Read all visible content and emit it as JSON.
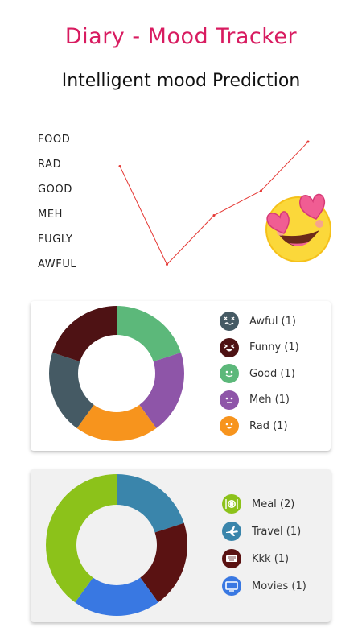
{
  "header": {
    "title": "Diary - Mood Tracker",
    "subtitle": "Intelligent mood Prediction"
  },
  "chart_data": [
    {
      "type": "line",
      "title": "",
      "y_categories": [
        "FOOD",
        "RAD",
        "GOOD",
        "MEH",
        "FUGLY",
        "AWFUL"
      ],
      "series": [
        {
          "values": [
            "RAD",
            "AWFUL",
            "MEH",
            "GOOD",
            "FOOD"
          ],
          "color": "#e53935"
        }
      ]
    },
    {
      "type": "pie",
      "donut": true,
      "slices": [
        {
          "label": "Awful (1)",
          "value": 1,
          "color": "#455a64",
          "icon": "dizzy-face-icon"
        },
        {
          "label": "Funny (1)",
          "value": 1,
          "color": "#4e1214",
          "icon": "laughing-face-icon"
        },
        {
          "label": "Good (1)",
          "value": 1,
          "color": "#5cb87a",
          "icon": "smiling-face-icon"
        },
        {
          "label": "Meh (1)",
          "value": 1,
          "color": "#8e55a8",
          "icon": "neutral-face-icon"
        },
        {
          "label": "Rad (1)",
          "value": 1,
          "color": "#f7941d",
          "icon": "happy-face-icon"
        }
      ],
      "chart_order": [
        2,
        3,
        4,
        0,
        1
      ]
    },
    {
      "type": "pie",
      "donut": true,
      "slices": [
        {
          "label": "Meal (2)",
          "value": 2,
          "color": "#8cc21a",
          "icon": "plate-cutlery-icon"
        },
        {
          "label": "Travel (1)",
          "value": 1,
          "color": "#3a85ab",
          "icon": "airplane-icon"
        },
        {
          "label": "Kkk (1)",
          "value": 1,
          "color": "#5a1212",
          "icon": "keyboard-icon"
        },
        {
          "label": "Movies (1)",
          "value": 1,
          "color": "#3978e2",
          "icon": "tv-icon"
        }
      ],
      "chart_order": [
        1,
        2,
        3,
        0
      ]
    }
  ]
}
